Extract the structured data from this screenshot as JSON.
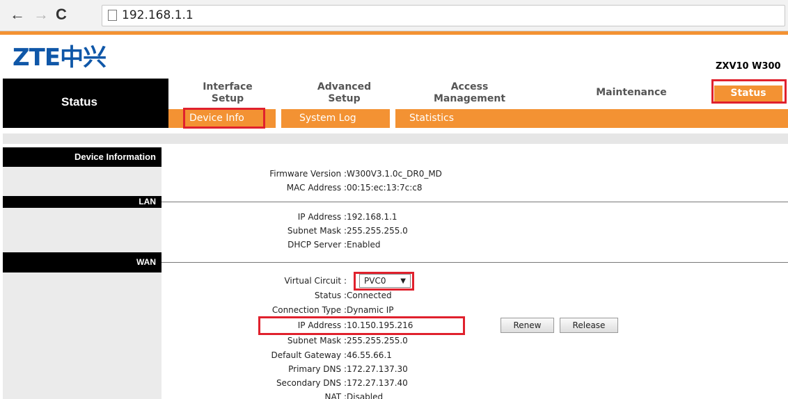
{
  "browser": {
    "back_icon": "←",
    "forward_icon": "→",
    "reload_icon": "C",
    "url": "192.168.1.1"
  },
  "header": {
    "logo": "ZTE中兴",
    "model": "ZXV10 W300",
    "brand_color": "#0f57a8",
    "accent_color": "#f39233",
    "highlight_color": "#e0212d"
  },
  "menu": {
    "left_title": "Status",
    "top_items": [
      {
        "line1": "Interface",
        "line2": "Setup"
      },
      {
        "line1": "Advanced",
        "line2": "Setup"
      },
      {
        "line1": "Access",
        "line2": "Management"
      },
      {
        "line1": "Maintenance",
        "line2": ""
      },
      {
        "line1": "Status",
        "line2": ""
      }
    ],
    "sub_items": [
      "Device Info",
      "System Log",
      "Statistics"
    ]
  },
  "sections": {
    "device_info": {
      "title": "Device Information",
      "rows": [
        {
          "label": "Firmware Version :",
          "value": "W300V3.1.0c_DR0_MD"
        },
        {
          "label": "MAC Address :",
          "value": "00:15:ec:13:7c:c8"
        }
      ]
    },
    "lan": {
      "title": "LAN",
      "rows": [
        {
          "label": "IP Address :",
          "value": "192.168.1.1"
        },
        {
          "label": "Subnet Mask :",
          "value": "255.255.255.0"
        },
        {
          "label": "DHCP Server :",
          "value": "Enabled"
        }
      ]
    },
    "wan": {
      "title": "WAN",
      "virtual_circuit_label": "Virtual Circuit :",
      "virtual_circuit_value": "PVC0",
      "rows": [
        {
          "label": "Status :",
          "value": "Connected"
        },
        {
          "label": "Connection Type :",
          "value": "Dynamic IP"
        },
        {
          "label": "IP Address :",
          "value": "10.150.195.216"
        },
        {
          "label": "Subnet Mask :",
          "value": "255.255.255.0"
        },
        {
          "label": "Default Gateway :",
          "value": "46.55.66.1"
        },
        {
          "label": "Primary DNS :",
          "value": "172.27.137.30"
        },
        {
          "label": "Secondary DNS :",
          "value": "172.27.137.40"
        },
        {
          "label": "NAT :",
          "value": "Disabled"
        }
      ],
      "renew_label": "Renew",
      "release_label": "Release"
    }
  }
}
